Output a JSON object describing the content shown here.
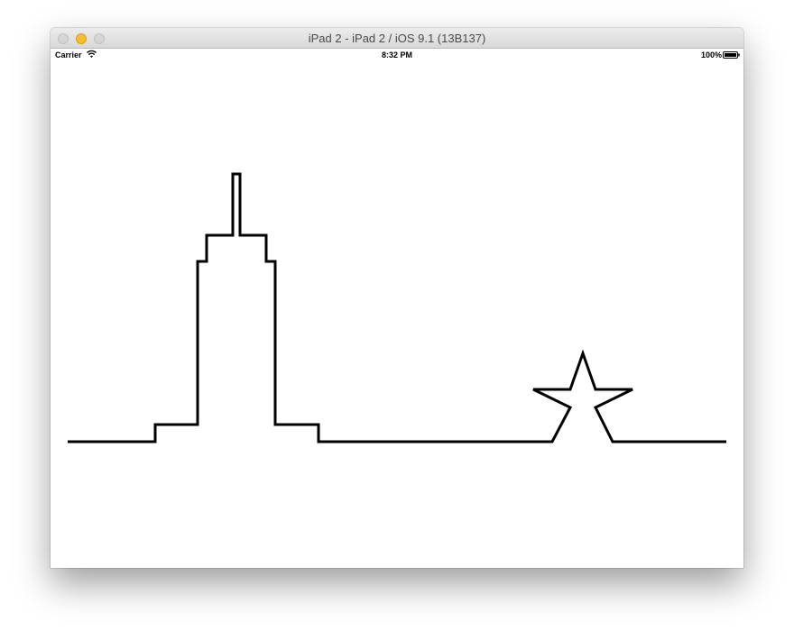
{
  "window": {
    "title": "iPad 2 - iPad 2 / iOS 9.1 (13B137)"
  },
  "status_bar": {
    "carrier": "Carrier",
    "time": "8:32 PM",
    "battery": "100%"
  },
  "icons": {
    "wifi": "wifi-icon",
    "battery": "battery-icon"
  },
  "colors": {
    "stroke": "#000000",
    "minimize_button": "#f5bd2f"
  }
}
